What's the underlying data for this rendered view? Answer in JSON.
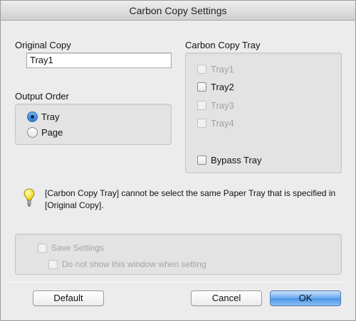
{
  "window": {
    "title": "Carbon Copy Settings"
  },
  "original_copy": {
    "label": "Original Copy",
    "value": "Tray1"
  },
  "output_order": {
    "label": "Output Order",
    "options": [
      {
        "label": "Tray",
        "selected": true
      },
      {
        "label": "Page",
        "selected": false
      }
    ]
  },
  "carbon_copy_tray": {
    "label": "Carbon Copy Tray",
    "items": [
      {
        "label": "Tray1",
        "checked": false,
        "enabled": false
      },
      {
        "label": "Tray2",
        "checked": false,
        "enabled": true
      },
      {
        "label": "Tray3",
        "checked": false,
        "enabled": false
      },
      {
        "label": "Tray4",
        "checked": false,
        "enabled": false
      },
      {
        "label": "Bypass Tray",
        "checked": false,
        "enabled": true
      }
    ]
  },
  "hint": {
    "icon": "lightbulb-icon",
    "text": "[Carbon Copy Tray] cannot be select the same Paper Tray that is specified in [Original Copy]."
  },
  "save_settings": {
    "label": "Save Settings",
    "do_not_show_label": "Do not show this window when setting"
  },
  "buttons": {
    "default": "Default",
    "cancel": "Cancel",
    "ok": "OK"
  }
}
